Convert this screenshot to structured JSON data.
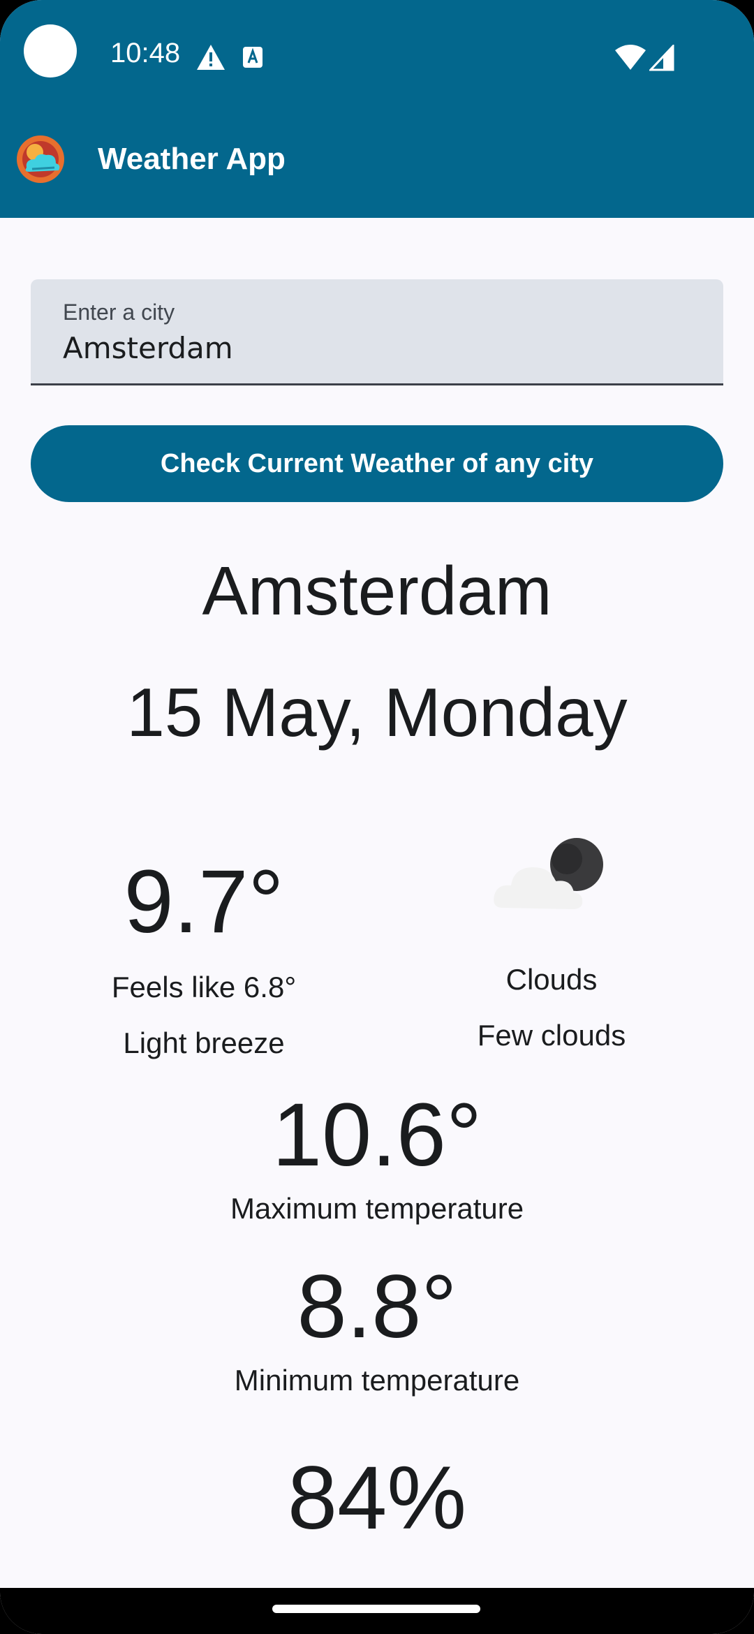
{
  "status_bar": {
    "time": "10:48",
    "icons": [
      "camera-dot",
      "warning-icon",
      "a-badge-icon",
      "wifi-icon",
      "signal-icon"
    ]
  },
  "app_bar": {
    "title": "Weather App",
    "logo_icon": "weather-logo-icon"
  },
  "search": {
    "label": "Enter a city",
    "value": "Amsterdam",
    "button_label": "Check Current Weather of any city"
  },
  "weather": {
    "city": "Amsterdam",
    "date": "15 May, Monday",
    "current_temp": "9.7°",
    "feels_like": "Feels like 6.8°",
    "wind": "Light breeze",
    "condition_icon": "cloud-moon-icon",
    "condition": "Clouds",
    "condition_desc": "Few clouds",
    "max_temp": "10.6°",
    "max_label": "Maximum temperature",
    "min_temp": "8.8°",
    "min_label": "Minimum temperature",
    "humidity": "84%"
  },
  "colors": {
    "primary": "#03678D",
    "background": "#FAF9FD",
    "field_bg": "#DFE3EA",
    "text": "#1A1C1E"
  }
}
